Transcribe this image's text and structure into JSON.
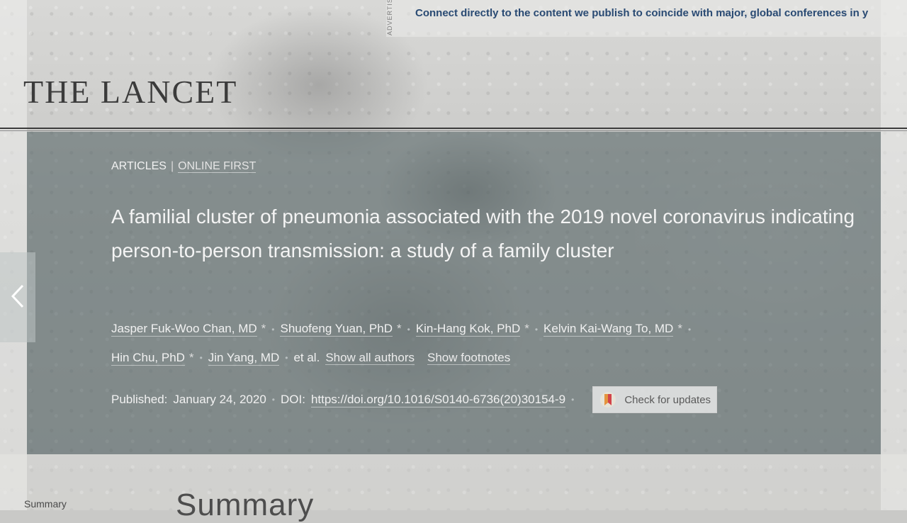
{
  "advertisement": {
    "label": "ADVERTISEMENT",
    "text": "Connect directly to the content we publish to coincide with major, global conferences in y"
  },
  "journal": {
    "name": "THE LANCET"
  },
  "article": {
    "breadcrumbs": [
      "ARTICLES",
      "ONLINE FIRST"
    ],
    "title": "A familial cluster of pneumonia associated with the 2019 novel coronavirus indicating person-to-person transmission: a study of a family cluster",
    "authors": [
      "Jasper Fuk-Woo Chan, MD",
      "Shuofeng Yuan, PhD",
      "Kin-Hang Kok, PhD",
      "Kelvin Kai-Wang To, MD",
      "Hin Chu, PhD",
      "Jin Yang, MD"
    ],
    "author_marker": "*",
    "et_al": "et al.",
    "show_all_authors": "Show all authors",
    "show_footnotes": "Show footnotes",
    "published_label": "Published:",
    "published_date": "January 24, 2020",
    "doi_label": "DOI:",
    "doi_url": "https://doi.org/10.1016/S0140-6736(20)30154-9",
    "check_updates": "Check for updates"
  },
  "nav": {
    "summary_link": "Summary"
  },
  "sections": {
    "summary_heading": "Summary"
  },
  "colors": {
    "ad_text": "#294a73",
    "hero_overlay": "#566568",
    "check_icon_red": "#d2434a"
  },
  "icons": {
    "prev": "chevron-left-icon",
    "check_updates": "bookmark-badge-icon"
  }
}
